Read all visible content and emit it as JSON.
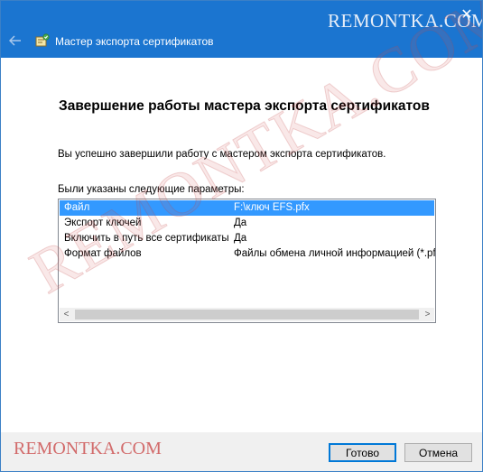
{
  "window": {
    "title": "Мастер экспорта сертификатов",
    "close_glyph": "✕",
    "back_glyph": "←",
    "back_icon": "back-arrow-icon",
    "wizard_icon": "certificate-wizard-icon"
  },
  "watermark": {
    "top": "REMONTKA.COM",
    "diagonal": "REMONTKA.COM",
    "bottom": "REMONTKA.COM"
  },
  "content": {
    "heading": "Завершение работы мастера экспорта сертификатов",
    "success_text": "Вы успешно завершили работу с мастером экспорта сертификатов.",
    "params_label": "Были указаны следующие параметры:",
    "params": [
      {
        "name": "Файл",
        "value": "F:\\ключ EFS.pfx",
        "selected": true
      },
      {
        "name": "Экспорт ключей",
        "value": "Да",
        "selected": false
      },
      {
        "name": "Включить в путь все сертификаты",
        "value": "Да",
        "selected": false
      },
      {
        "name": "Формат файлов",
        "value": "Файлы обмена личной информацией (*.pfx)",
        "selected": false
      }
    ],
    "scroll_left_glyph": "<",
    "scroll_right_glyph": ">"
  },
  "buttons": {
    "finish": "Готово",
    "cancel": "Отмена"
  },
  "colors": {
    "titlebar": "#1b75d0",
    "selection": "#3399ff",
    "default_button_border": "#0078d7"
  }
}
